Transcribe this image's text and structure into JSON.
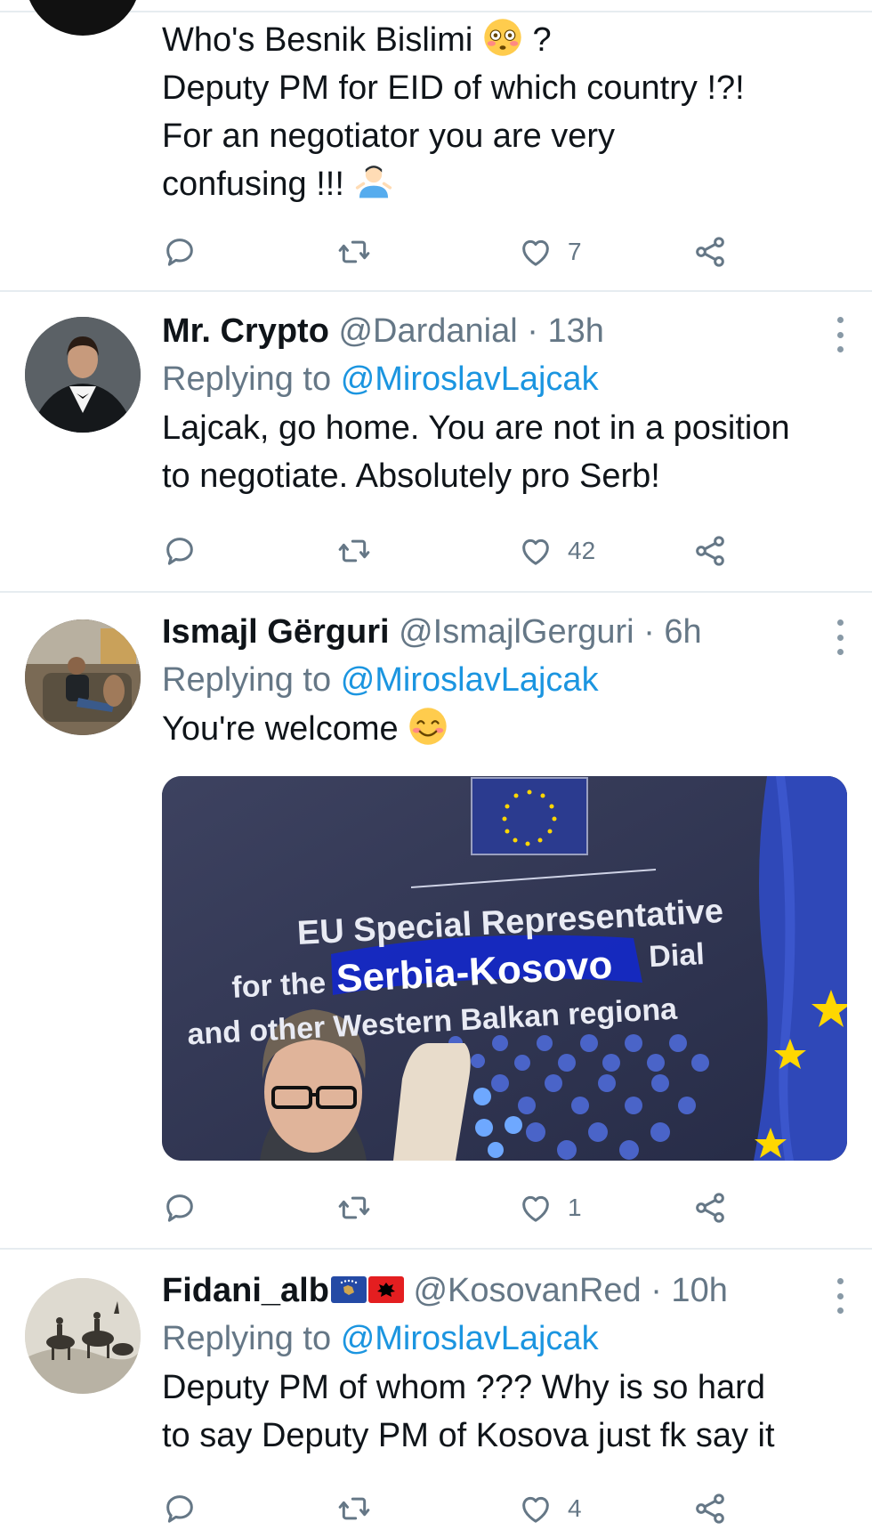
{
  "tweets": [
    {
      "name": "",
      "handle": "",
      "time": "",
      "reply_prefix": "",
      "reply_to": "",
      "text_lines": [
        "Who's Besnik Bislimi",
        "Deputy PM for EID of which country !?!",
        "For an negotiator you are very",
        "confusing !!!"
      ],
      "line1_suffix": "?",
      "likes": "7",
      "emoji_flushed": "flushed-face-emoji",
      "emoji_shrug": "man-shrugging-emoji"
    },
    {
      "name": "Mr. Crypto",
      "handle": "@Dardanial",
      "time": "· 13h",
      "reply_prefix": "Replying to",
      "reply_to": "@MiroslavLajcak",
      "text_lines": [
        "Lajcak, go home. You are not in a position",
        "to negotiate. Absolutely pro Serb!"
      ],
      "likes": "42"
    },
    {
      "name": "Ismajl Gërguri",
      "handle": "@IsmajlGerguri",
      "time": "· 6h",
      "reply_prefix": "Replying to",
      "reply_to": "@MiroslavLajcak",
      "text_lines": [
        "You're welcome"
      ],
      "likes": "1",
      "emoji_smile": "smiling-face-emoji",
      "image": {
        "line1": "EU Special Representative",
        "line2_prefix": "for the",
        "line2_highlight": "Serbia-Kosovo",
        "line2_suffix": "Dial",
        "line3": "and other Western Balkan regiona"
      }
    },
    {
      "name": "Fidani_alb",
      "handle": "@KosovanRed",
      "time": "· 10h",
      "reply_prefix": "Replying to",
      "reply_to": "@MiroslavLajcak",
      "text_lines": [
        "Deputy PM of whom ??? Why is so hard",
        "to say Deputy PM of Kosova just fk say it"
      ],
      "likes": "4",
      "flags": [
        "kosovo-flag-emoji",
        "albania-flag-emoji"
      ]
    }
  ],
  "icons": {
    "reply": "reply-icon",
    "retweet": "retweet-icon",
    "like": "heart-icon",
    "share": "share-icon",
    "more": "more-icon"
  },
  "colors": {
    "link": "#1b95e0",
    "secondary_text": "#657786",
    "divider": "#e6ecf0",
    "icon": "#657786"
  }
}
